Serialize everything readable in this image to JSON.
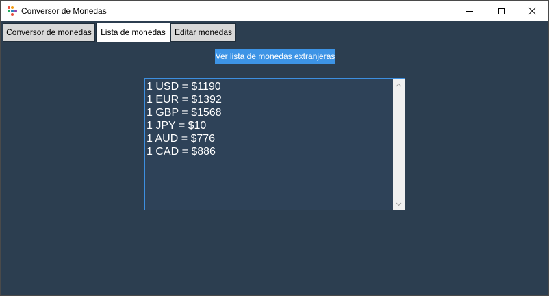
{
  "window": {
    "title": "Conversor de Monedas"
  },
  "tabs": [
    {
      "label": "Conversor de monedas",
      "active": false
    },
    {
      "label": "Lista de monedas",
      "active": true
    },
    {
      "label": "Editar monedas",
      "active": false
    }
  ],
  "content": {
    "show_button_label": "Ver lista de monedas extranjeras",
    "rates": [
      "1 USD = $1190",
      "1 EUR = $1392",
      "1 GBP = $1568",
      "1 JPY = $10",
      "1 AUD = $776",
      "1 CAD = $886"
    ]
  },
  "colors": {
    "background": "#2c3e50",
    "accent": "#3d94e6",
    "listbox_bg": "#2e4258"
  }
}
